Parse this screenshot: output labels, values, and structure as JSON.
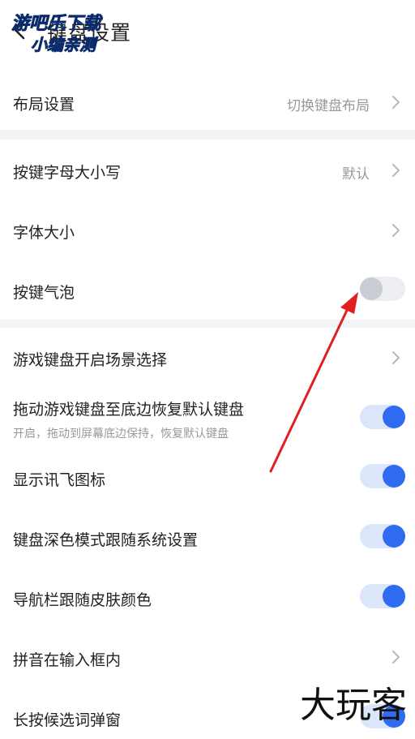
{
  "header": {
    "title": "键盘设置",
    "back_icon": "chevron-left-icon"
  },
  "watermarks": {
    "top_left_line1": "游吧乐下载",
    "top_left_line2": "小编亲测",
    "bottom_right": "大玩客"
  },
  "sections": [
    {
      "rows": [
        {
          "label": "布局设置",
          "value": "切换键盘布局",
          "control": "chevron"
        }
      ]
    },
    {
      "rows": [
        {
          "label": "按键字母大小写",
          "value": "默认",
          "control": "chevron"
        },
        {
          "label": "字体大小",
          "value": "",
          "control": "chevron"
        },
        {
          "label": "按键气泡",
          "control": "toggle",
          "checked": false
        }
      ]
    },
    {
      "rows": [
        {
          "label": "游戏键盘开启场景选择",
          "value": "",
          "control": "chevron"
        },
        {
          "label": "拖动游戏键盘至底边恢复默认键盘",
          "subtitle": "开启，拖动到屏幕底边保持，恢复默认键盘",
          "control": "toggle",
          "checked": true
        },
        {
          "label": "显示讯飞图标",
          "control": "toggle",
          "checked": true
        },
        {
          "label": "键盘深色模式跟随系统设置",
          "control": "toggle",
          "checked": true
        },
        {
          "label": "导航栏跟随皮肤颜色",
          "control": "toggle",
          "checked": true
        },
        {
          "label": "拼音在输入框内",
          "value": "",
          "control": "chevron"
        },
        {
          "label": "长按候选词弹窗",
          "control": "toggle",
          "checked": true
        }
      ]
    }
  ],
  "colors": {
    "accent": "#2f6bf0",
    "annotation_arrow": "#e02020",
    "section_gap": "#f2f3f5"
  }
}
